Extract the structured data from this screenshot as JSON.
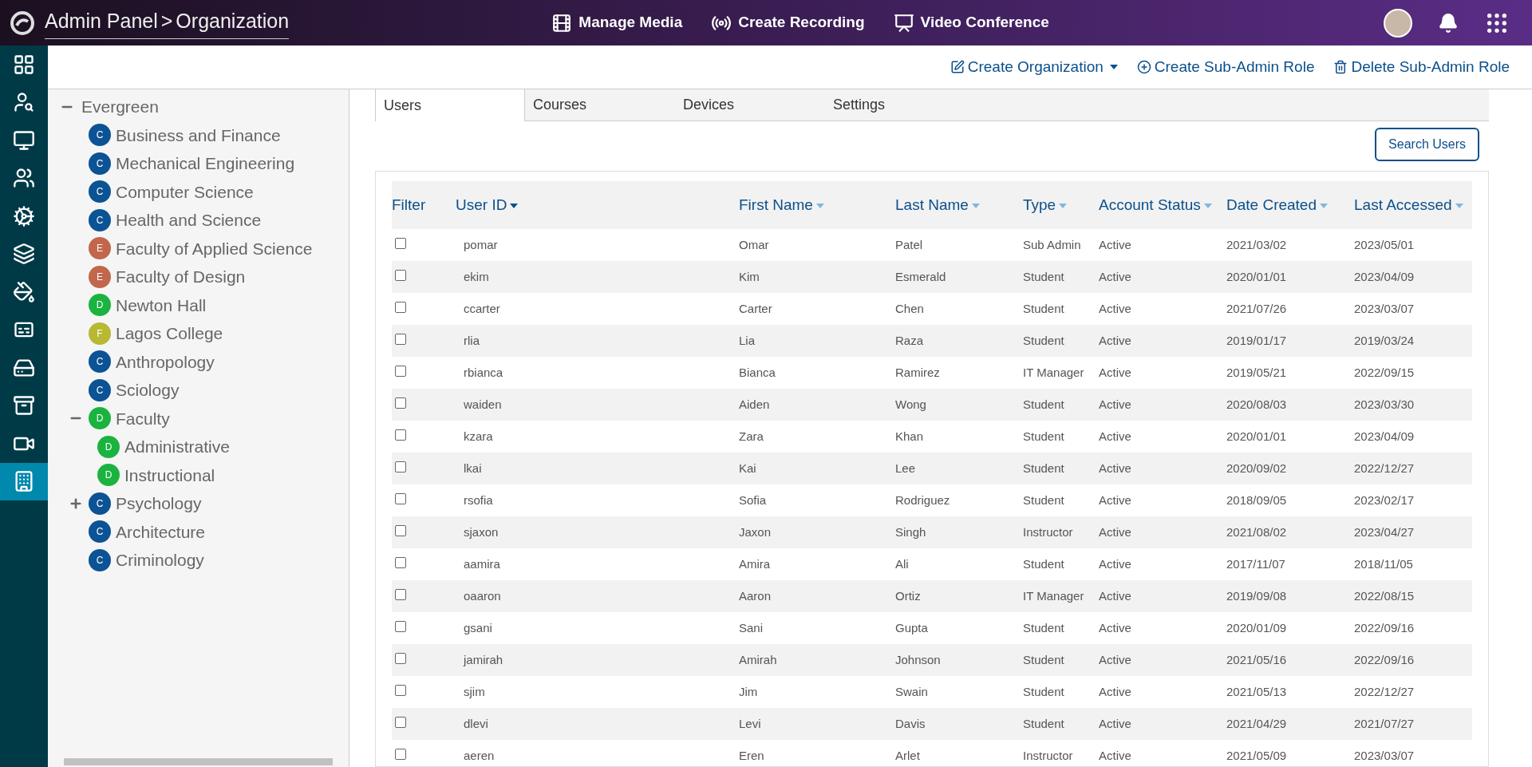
{
  "header": {
    "breadcrumb": "Admin Panel",
    "separator": ">",
    "page": "Organization",
    "nav": [
      {
        "label": "Manage Media",
        "kind": "media"
      },
      {
        "label": "Create Recording",
        "kind": "recording"
      },
      {
        "label": "Video Conference",
        "kind": "conference"
      }
    ]
  },
  "sidebar": {
    "items": [
      {
        "kind": "dashboard",
        "selected": false
      },
      {
        "kind": "search-user",
        "selected": false
      },
      {
        "kind": "monitor",
        "selected": false
      },
      {
        "kind": "group",
        "selected": false
      },
      {
        "kind": "gears",
        "selected": false
      },
      {
        "kind": "layers",
        "selected": false
      },
      {
        "kind": "paint",
        "selected": false
      },
      {
        "kind": "cc",
        "selected": false
      },
      {
        "kind": "drive",
        "selected": false
      },
      {
        "kind": "archive",
        "selected": false
      },
      {
        "kind": "camera",
        "selected": false
      },
      {
        "kind": "building",
        "selected": true
      }
    ]
  },
  "actions": [
    {
      "label": "Create Organization",
      "kind": "edit",
      "dropdown": true
    },
    {
      "label": "Create Sub-Admin Role",
      "kind": "add",
      "dropdown": false
    },
    {
      "label": "Delete Sub-Admin Role",
      "kind": "delete",
      "dropdown": false
    }
  ],
  "tree": {
    "label": "Evergreen",
    "expanded": true,
    "children": [
      {
        "label": "Business and Finance",
        "badge": "C",
        "color": "#0b5394"
      },
      {
        "label": "Mechanical Engineering",
        "badge": "C",
        "color": "#0b5394"
      },
      {
        "label": "Computer Science",
        "badge": "C",
        "color": "#0b5394"
      },
      {
        "label": "Health and Science",
        "badge": "C",
        "color": "#0b5394"
      },
      {
        "label": "Faculty of Applied Science",
        "badge": "E",
        "color": "#c2664c"
      },
      {
        "label": "Faculty of Design",
        "badge": "E",
        "color": "#c2664c"
      },
      {
        "label": "Newton Hall",
        "badge": "D",
        "color": "#1bb340"
      },
      {
        "label": "Lagos College",
        "badge": "F",
        "color": "#b8b832"
      },
      {
        "label": "Anthropology",
        "badge": "C",
        "color": "#0b5394"
      },
      {
        "label": "Sciology",
        "badge": "C",
        "color": "#0b5394"
      },
      {
        "label": "Faculty",
        "badge": "D",
        "color": "#1bb340",
        "expanded": true,
        "children": [
          {
            "label": "Administrative",
            "badge": "D",
            "color": "#1bb340"
          },
          {
            "label": "Instructional",
            "badge": "D",
            "color": "#1bb340"
          }
        ]
      },
      {
        "label": "Psychology",
        "badge": "C",
        "color": "#0b5394",
        "expanded": false
      },
      {
        "label": "Architecture",
        "badge": "C",
        "color": "#0b5394"
      },
      {
        "label": "Criminology",
        "badge": "C",
        "color": "#0b5394"
      }
    ]
  },
  "tabs": [
    {
      "label": "Users",
      "selected": true
    },
    {
      "label": "Courses",
      "selected": false
    },
    {
      "label": "Devices",
      "selected": false
    },
    {
      "label": "Settings",
      "selected": false
    }
  ],
  "search_button": "Search Users",
  "table": {
    "filter_label": "Filter",
    "columns": [
      {
        "label": "User ID",
        "sorted": true
      },
      {
        "label": "First Name",
        "sorted": false
      },
      {
        "label": "Last Name",
        "sorted": false
      },
      {
        "label": "Type",
        "sorted": false
      },
      {
        "label": "Account Status",
        "sorted": false
      },
      {
        "label": "Date Created",
        "sorted": false
      },
      {
        "label": "Last Accessed",
        "sorted": false
      }
    ],
    "rows": [
      {
        "checked": false,
        "cells": [
          "pomar",
          "Omar",
          "Patel",
          "Sub Admin",
          "Active",
          "2021/03/02",
          "2023/05/01"
        ]
      },
      {
        "checked": false,
        "cells": [
          "ekim",
          "Kim",
          "Esmerald",
          "Student",
          "Active",
          "2020/01/01",
          "2023/04/09"
        ]
      },
      {
        "checked": false,
        "cells": [
          "ccarter",
          "Carter",
          "Chen",
          "Student",
          "Active",
          "2021/07/26",
          "2023/03/07"
        ]
      },
      {
        "checked": false,
        "cells": [
          "rlia",
          "Lia",
          "Raza",
          "Student",
          "Active",
          "2019/01/17",
          "2019/03/24"
        ]
      },
      {
        "checked": false,
        "cells": [
          "rbianca",
          "Bianca",
          "Ramirez",
          "IT Manager",
          "Active",
          "2019/05/21",
          "2022/09/15"
        ]
      },
      {
        "checked": false,
        "cells": [
          "waiden",
          "Aiden",
          "Wong",
          "Student",
          "Active",
          "2020/08/03",
          "2023/03/30"
        ]
      },
      {
        "checked": false,
        "cells": [
          "kzara",
          "Zara",
          "Khan",
          "Student",
          "Active",
          "2020/01/01",
          "2023/04/09"
        ]
      },
      {
        "checked": false,
        "cells": [
          "lkai",
          "Kai",
          "Lee",
          "Student",
          "Active",
          "2020/09/02",
          "2022/12/27"
        ]
      },
      {
        "checked": false,
        "cells": [
          "rsofia",
          "Sofia",
          "Rodriguez",
          "Student",
          "Active",
          "2018/09/05",
          "2023/02/17"
        ]
      },
      {
        "checked": false,
        "cells": [
          "sjaxon",
          "Jaxon",
          "Singh",
          "Instructor",
          "Active",
          "2021/08/02",
          "2023/04/27"
        ]
      },
      {
        "checked": false,
        "cells": [
          "aamira",
          "Amira",
          "Ali",
          "Student",
          "Active",
          "2017/11/07",
          "2018/11/05"
        ]
      },
      {
        "checked": false,
        "cells": [
          "oaaron",
          "Aaron",
          "Ortiz",
          "IT Manager",
          "Active",
          "2019/09/08",
          "2022/08/15"
        ]
      },
      {
        "checked": false,
        "cells": [
          "gsani",
          "Sani",
          "Gupta",
          "Student",
          "Active",
          "2020/01/09",
          "2022/09/16"
        ]
      },
      {
        "checked": false,
        "cells": [
          "jamirah",
          "Amirah",
          "Johnson",
          "Student",
          "Active",
          "2021/05/16",
          "2022/09/16"
        ]
      },
      {
        "checked": false,
        "cells": [
          "sjim",
          "Jim",
          "Swain",
          "Student",
          "Active",
          "2021/05/13",
          "2022/12/27"
        ]
      },
      {
        "checked": false,
        "cells": [
          "dlevi",
          "Levi",
          "Davis",
          "Student",
          "Active",
          "2021/04/29",
          "2021/07/27"
        ]
      },
      {
        "checked": false,
        "cells": [
          "aeren",
          "Eren",
          "Arlet",
          "Instructor",
          "Active",
          "2021/05/09",
          "2023/03/07"
        ]
      }
    ]
  }
}
